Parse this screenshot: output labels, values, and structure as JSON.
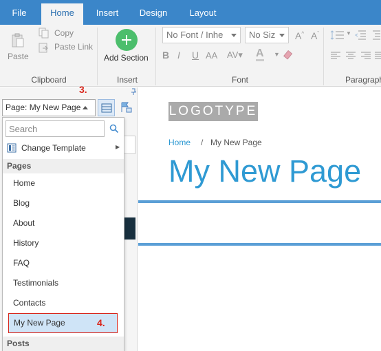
{
  "menu": {
    "tabs": [
      "File",
      "Home",
      "Insert",
      "Design",
      "Layout"
    ],
    "active": "Home"
  },
  "ribbon": {
    "clipboard": {
      "paste": "Paste",
      "copy": "Copy",
      "paste_link": "Paste Link",
      "label": "Clipboard"
    },
    "insert": {
      "add_section": "Add Section",
      "label": "Insert"
    },
    "font": {
      "family": "No Font / Inhe",
      "size": "No Siz",
      "label": "Font"
    },
    "paragraph": {
      "label": "Paragraph"
    }
  },
  "left_panel": {
    "page_selector": "Page: My New Page",
    "step3": "3."
  },
  "dropdown": {
    "search_placeholder": "Search",
    "change_template": "Change Template",
    "pages_header": "Pages",
    "pages": [
      "Home",
      "Blog",
      "About",
      "History",
      "FAQ",
      "Testimonials",
      "Contacts",
      "My New Page"
    ],
    "selected": "My New Page",
    "step4": "4.",
    "posts_header": "Posts"
  },
  "canvas": {
    "logo": "LOGOTYPE",
    "breadcrumb_home": "Home",
    "breadcrumb_sep": "/",
    "breadcrumb_current": "My New Page",
    "title": "My New Page"
  },
  "colors": {
    "menu_bar": "#3b86c9",
    "accent": "#2f9ad3",
    "highlight": "#d9261c",
    "add_button": "#4cbe6c"
  }
}
